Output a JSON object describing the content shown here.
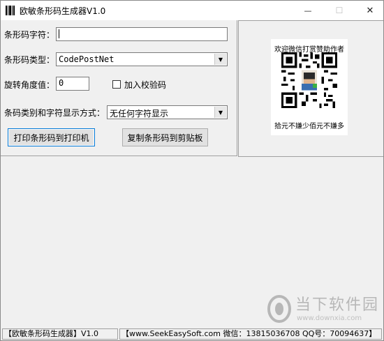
{
  "window": {
    "title": "欧敏条形码生成器V1.0"
  },
  "controls": {
    "minimize_glyph": "—",
    "maximize_glyph": "☐",
    "close_glyph": "✕"
  },
  "form": {
    "barcode_text_label": "条形码字符：",
    "barcode_text_value": "",
    "barcode_type_label": "条形码类型：",
    "barcode_type_value": "CodePostNet",
    "rotation_label": "旋转角度值：",
    "rotation_value": "0",
    "checksum_label": "加入校验码",
    "checksum_checked": false,
    "display_mode_label": "条码类别和字符显示方式：",
    "display_mode_value": "无任何字符显示",
    "print_button": "打印条形码到打印机",
    "copy_button": "复制条形码到剪贴板"
  },
  "donation": {
    "title": "欢迎微信打赏赞助作者",
    "footer": "拾元不嫌少佰元不嫌多",
    "qr_icon": "qr-code-icon"
  },
  "statusbar": {
    "app_name": "【欧敏条形码生成器】V1.0",
    "contact": "【www.SeekEasySoft.com 微信：13815036708 QQ号：70094637】"
  },
  "watermark": {
    "brand": "当下软件园",
    "url": "www.downxia.com"
  },
  "colors": {
    "window_bg": "#f0f0f0",
    "default_button_border": "#0078d7"
  }
}
